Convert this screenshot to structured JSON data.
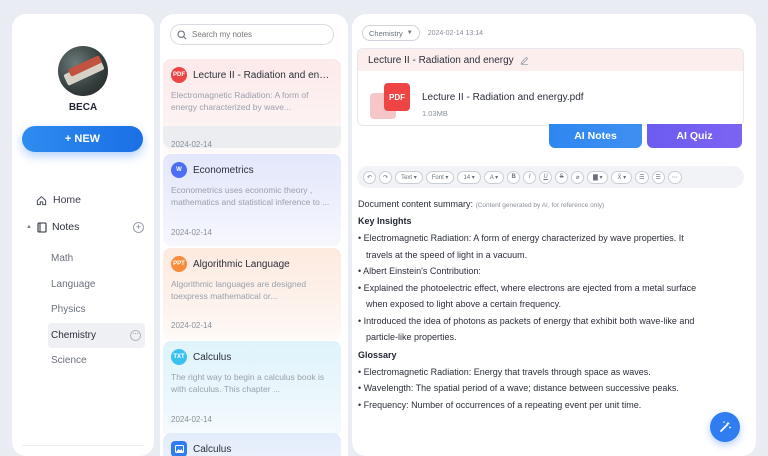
{
  "sidebar": {
    "user_name": "BECA",
    "new_button": "+ NEW",
    "home": "Home",
    "notes": "Notes",
    "subjects": [
      "Math",
      "Language",
      "Physics",
      "Chemistry",
      "Science"
    ],
    "active_subject": "Chemistry"
  },
  "search": {
    "placeholder": "Search my notes"
  },
  "notes_list": [
    {
      "badge": "PDF",
      "badge_color": "#ef4444",
      "title": "Lecture II - Radiation and ene...",
      "excerpt": "Electromagnetic Radiation: A form of energy characterized by wave...",
      "date": "2024-02-14"
    },
    {
      "badge": "W",
      "badge_color": "#4c6ef5",
      "title": "Econometrics",
      "excerpt": "Econometrics uses economic theory , mathematics  and statistical inference to ...",
      "date": "2024-02-14"
    },
    {
      "badge": "PPT",
      "badge_color": "#f78c3a",
      "title": "Algorithmic Language",
      "excerpt": "Algorithmic languages are designed toexpress mathematical or...",
      "date": "2024-02-14"
    },
    {
      "badge": "TXT",
      "badge_color": "#3cc0f0",
      "title": "Calculus",
      "excerpt": "The right way to begin a calculus book is with calculus. This chapter ...",
      "date": "2024-02-14"
    },
    {
      "badge": "IMG",
      "badge_color": "#2f7df0",
      "title": "Calculus",
      "excerpt": "",
      "date": ""
    }
  ],
  "main": {
    "category": "Chemistry",
    "timestamp": "2024-02-14 13:14",
    "doc_title": "Lecture II - Radiation and energy",
    "file_badge": "PDF",
    "file_name": "Lecture II - Radiation and energy.pdf",
    "file_size": "1.03MB",
    "ai_notes": "AI Notes",
    "ai_quiz": "AI Quiz",
    "toolbar": {
      "undo": "↶",
      "redo": "↷",
      "text": "Text ▾",
      "font": "Font ▾",
      "size": "14 ▾",
      "color": "A ▾",
      "bold": "B",
      "italic": "I",
      "underline": "U",
      "strike": "S",
      "eraser": "⌀",
      "highlight": "▇ ▾",
      "sub": "X̄ ▾",
      "list1": "☰",
      "list2": "☰",
      "more": "⋯"
    },
    "summary_label": "Document content summary:",
    "summary_note": "(Content generated by AI, for reference only)",
    "key_insights_title": "Key Insights",
    "key_insights": [
      "• Electromagnetic Radiation: A form of energy characterized by wave properties. It",
      "   travels at the speed of light in a vacuum.",
      "• Albert Einstein's Contribution:",
      "• Explained the photoelectric effect, where electrons are ejected from a metal surface",
      "   when exposed to light above a certain frequency.",
      "• Introduced the idea of photons as packets of energy that exhibit both wave-like and",
      "   particle-like properties."
    ],
    "glossary_title": "Glossary",
    "glossary": [
      "• Electromagnetic Radiation: Energy that travels through space as waves.",
      "• Wavelength: The spatial period of a wave; distance between successive peaks.",
      "• Frequency: Number of occurrences of a repeating event per unit time."
    ]
  }
}
